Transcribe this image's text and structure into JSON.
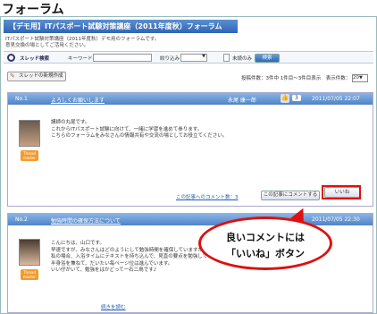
{
  "page_heading": "フォーラム",
  "forum": {
    "title": "【デモ用】ITパスポート試験対策講座（2011年度秋）フォーラム",
    "desc1": "ITパスポート試験対策講座（2011年度秋）デモ用のフォーラムです。",
    "desc2": "意見交換の場としてご活用ください。"
  },
  "search": {
    "title": "スレッド検索",
    "keyword_label": "キーワード",
    "filter_label": "絞り込み",
    "unread_label": "未読のみ",
    "button": "検索"
  },
  "toolbar": {
    "new_thread": "スレッドの新規作成",
    "info": "投稿件数：3件中 1件目〜3件目表示　表示件数：",
    "per_page": "20"
  },
  "posts": [
    {
      "no": "No.1",
      "title": "よろしくお願いします",
      "author": "永尾 康一郎",
      "likes": "3",
      "date": "2011/07/05 22:07",
      "badge": "Thread master",
      "lines": [
        "講師の丸尾です。",
        "これからITパスポート試験に向けて、一緒に学習を進めて参ります。",
        "こちらのフォーラムをみなさんの情報共有や交流の場としてお役立てください。"
      ],
      "comments_link": "この記事へのコメント数：3",
      "comment_button": "この記事にコメントする",
      "like_button": "いいね"
    },
    {
      "no": "No.2",
      "title": "勉強時間の確保方法について",
      "date": "2011/07/05 22:30",
      "badge": "Thread master",
      "lines": [
        "こんにちは、山口です。",
        "早速ですが、みなさんはどのようにして勉強時間を確保していますか？",
        "私の場合、入浴タイムにテキストを持ち込んで、見直の要点を勉強しています。",
        "半身浴を兼ねて、だいたい毎ページ位は進んでいます。",
        "いい仔がいて、勉強をはかどって一石二鳥です♪"
      ],
      "more_link": "続きを読む"
    }
  ],
  "callout": {
    "line1": "良いコメントには",
    "line2": "「いいね」ボタン"
  }
}
